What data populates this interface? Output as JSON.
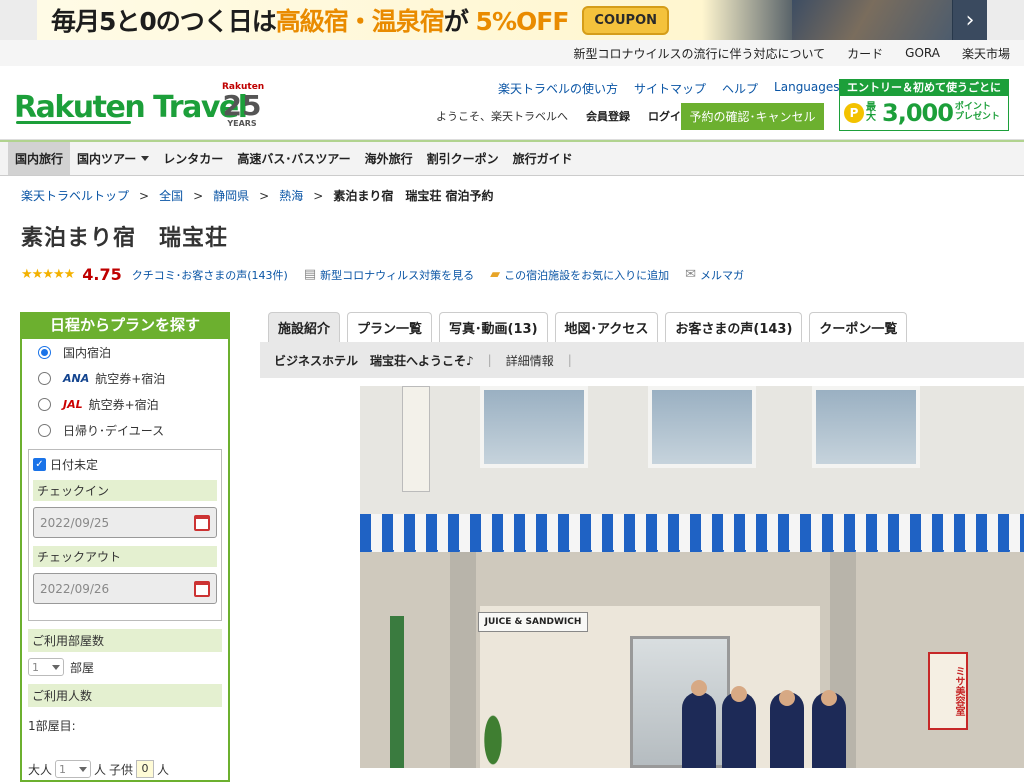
{
  "banner": {
    "text_pre": "毎月5と0のつく日は",
    "text_hl": "高級宿・温泉宿",
    "text_mid": "が",
    "text_off": "5%OFF",
    "coupon": "COUPON",
    "next_icon": "chevron-right-icon"
  },
  "util_nav": [
    "新型コロナウイルスの流行に伴う対応について",
    "カード",
    "GORA",
    "楽天市場"
  ],
  "header": {
    "logo": "Rakuten Travel",
    "years_brand": "Rakuten",
    "years_num": "25",
    "years_label": "YEARS",
    "links": [
      "楽天トラベルの使い方",
      "サイトマップ",
      "ヘルプ",
      "Languages"
    ],
    "welcome": "ようこそ、楽天トラベルへ",
    "register": "会員登録",
    "login": "ログイン",
    "reserve_button": "予約の確認･キャンセル",
    "promo_top": "エントリー＆初めて使うごとに",
    "promo_coin": "P",
    "promo_max": "最大",
    "promo_amount": "3,000",
    "promo_point": "ポイント",
    "promo_present": "プレゼント"
  },
  "main_nav": [
    "国内旅行",
    "国内ツアー",
    "レンタカー",
    "高速バス･バスツアー",
    "海外旅行",
    "割引クーポン",
    "旅行ガイド"
  ],
  "breadcrumb": {
    "items": [
      "楽天トラベルトップ",
      "全国",
      "静岡県",
      "熱海"
    ],
    "current": "素泊まり宿　瑞宝荘 宿泊予約",
    "sep": ">"
  },
  "hotel": {
    "name": "素泊まり宿　瑞宝荘",
    "stars": "★★★★★",
    "score": "4.75",
    "reviews_link": "クチコミ･お客さまの声(143件)",
    "covid_link": "新型コロナウィルス対策を見る",
    "favorite_link": "この宿泊施設をお気に入りに追加",
    "mailmag_link": "メルマガ"
  },
  "sidebar": {
    "title": "日程からプランを探す",
    "options": [
      {
        "label": "国内宿泊",
        "air": "",
        "selected": true
      },
      {
        "label": "航空券+宿泊",
        "air": "ANA",
        "selected": false
      },
      {
        "label": "航空券+宿泊",
        "air": "JAL",
        "selected": false
      },
      {
        "label": "日帰り･デイユース",
        "air": "",
        "selected": false
      }
    ],
    "date_undecided": "日付未定",
    "checkin_label": "チェックイン",
    "checkin_value": "2022/09/25",
    "checkout_label": "チェックアウト",
    "checkout_value": "2022/09/26",
    "rooms_label": "ご利用部屋数",
    "rooms_value": "1",
    "rooms_unit": "部屋",
    "people_label": "ご利用人数",
    "room1_label": "1部屋目:",
    "adult_label": "大人",
    "adult_value": "1",
    "adult_unit": "人",
    "child_label": "子供",
    "child_value": "0",
    "child_unit": "人"
  },
  "tabs": [
    "施設紹介",
    "プラン一覧",
    "写真･動画(13)",
    "地図･アクセス",
    "お客さまの声(143)",
    "クーポン一覧"
  ],
  "subbar": {
    "welcome": "ビジネスホテル　瑞宝荘へようこそ♪",
    "sep": "|",
    "detail": "詳細情報"
  },
  "photo": {
    "shop_sign": "JUICE & SANDWICH",
    "right_sign": "ミサ美容室"
  }
}
